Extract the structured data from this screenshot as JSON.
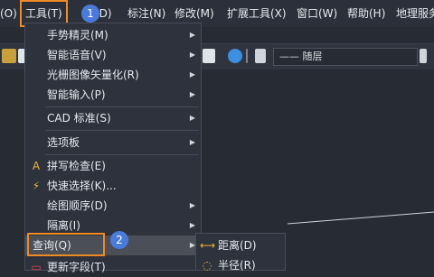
{
  "menubar": {
    "partial_left": "(O)",
    "tools": "工具(T)",
    "dim_tail": "(D)",
    "annotate": "标注(N)",
    "modify": "修改(M)",
    "ext_tools": "扩展工具(X)",
    "window": "窗口(W)",
    "help": "帮助(H)",
    "geo": "地理服务"
  },
  "toolbar": {
    "layer_value": "—— 随层"
  },
  "badges": {
    "one": "1",
    "two": "2"
  },
  "menu": {
    "items": [
      "手势精灵(M)",
      "智能语音(V)",
      "光栅图像矢量化(R)",
      "智能输入(P)",
      "CAD 标准(S)",
      "选项板",
      "拼写检查(E)",
      "快速选择(K)...",
      "绘图顺序(D)",
      "隔离(I)",
      "查询(Q)",
      "更新字段(T)"
    ]
  },
  "submenu": {
    "items": [
      "距离(D)",
      "半径(R)"
    ]
  }
}
